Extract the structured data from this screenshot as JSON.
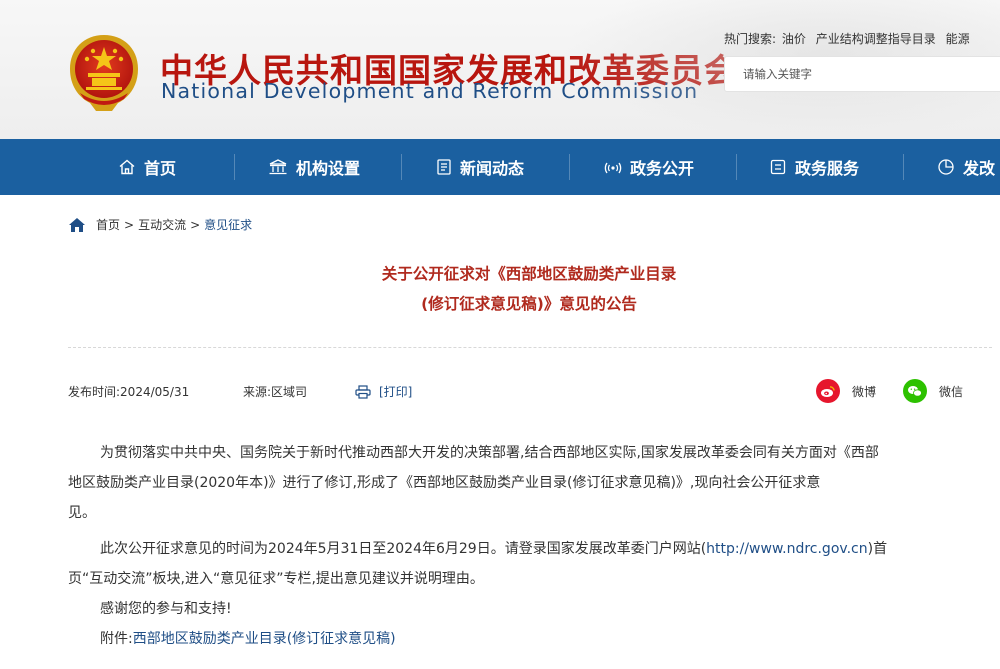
{
  "header": {
    "title_cn": "中华人民共和国国家发展和改革委员会",
    "title_en": "National Development and Reform Commission",
    "hot_label": "热门搜索:",
    "hot_items": [
      "油价",
      "产业结构调整指导目录",
      "能源"
    ],
    "search_placeholder": "请输入关键字"
  },
  "nav": {
    "items": [
      {
        "label": "首页",
        "icon": "home-icon"
      },
      {
        "label": "机构设置",
        "icon": "institution-icon"
      },
      {
        "label": "新闻动态",
        "icon": "news-icon"
      },
      {
        "label": "政务公开",
        "icon": "broadcast-icon"
      },
      {
        "label": "政务服务",
        "icon": "service-icon"
      },
      {
        "label": "发改",
        "icon": "chart-icon"
      }
    ]
  },
  "breadcrumb": {
    "home": "首页",
    "sep": ">",
    "section": "互动交流",
    "current": "意见征求"
  },
  "article": {
    "title_line1": "关于公开征求对《西部地区鼓励类产业目录",
    "title_line2": "(修订征求意见稿)》意见的公告",
    "publish_time": "发布时间:2024/05/31",
    "source": "来源:区域司",
    "print_label": "[打印]",
    "share_weibo": "微博",
    "share_wechat": "微信",
    "p1_line1": "为贯彻落实中共中央、国务院关于新时代推动西部大开发的决策部署,结合西部地区实际,国家发展改革委会同有关方面对《西部",
    "p1_line2": "地区鼓励类产业目录(2020年本)》进行了修订,形成了《西部地区鼓励类产业目录(修订征求意见稿)》,现向社会公开征求意",
    "p1_line3": "见。",
    "p2_line1_a": "此次公开征求意见的时间为2024年5月31日至2024年6月29日。请登录国家发展改革委门户网站(",
    "p2_url": "http://www.ndrc.gov.cn",
    "p2_line1_b": ")首",
    "p2_line2": "页“互动交流”板块,进入“意见征求”专栏,提出意见建议并说明理由。",
    "p3": "感谢您的参与和支持!",
    "attachment_label": "附件:",
    "attachment_link": "西部地区鼓励类产业目录(修订征求意见稿)"
  },
  "colors": {
    "nav_bg": "#1b60a0",
    "title_red": "#b8160f",
    "title_blue": "#1f4e86",
    "article_title": "#b02a1e",
    "weibo": "#e6162d",
    "wechat": "#2dc100"
  }
}
